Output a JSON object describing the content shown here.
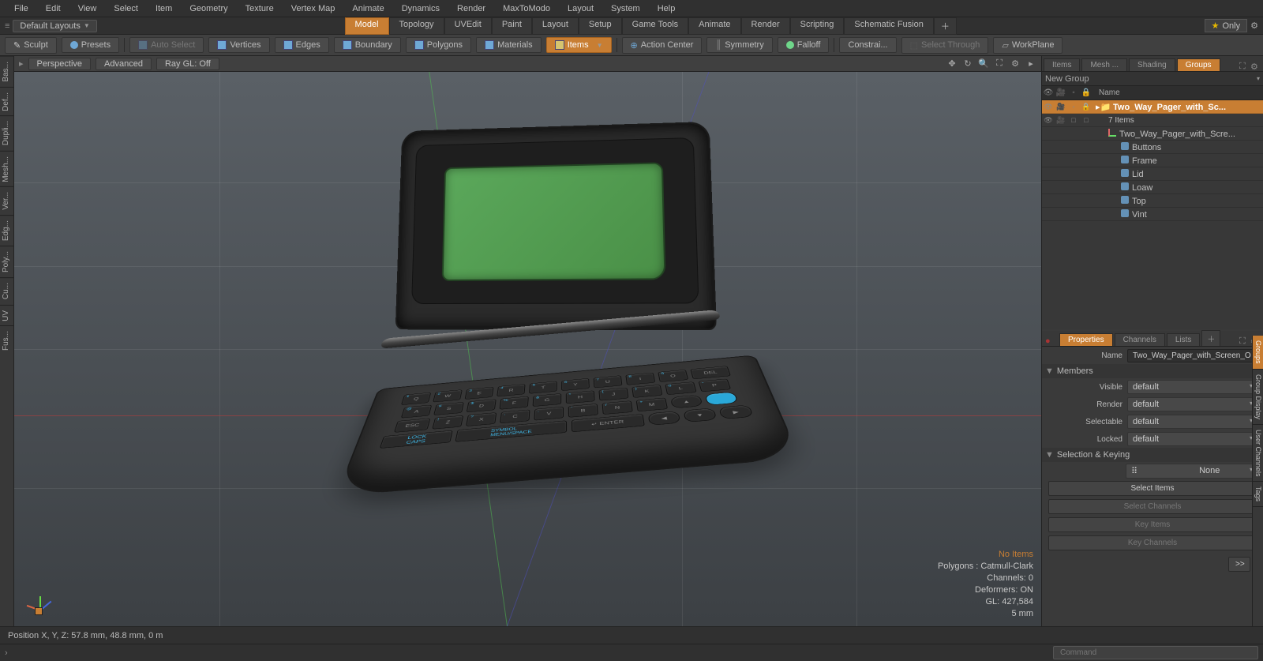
{
  "menubar": [
    "File",
    "Edit",
    "View",
    "Select",
    "Item",
    "Geometry",
    "Texture",
    "Vertex Map",
    "Animate",
    "Dynamics",
    "Render",
    "MaxToModo",
    "Layout",
    "System",
    "Help"
  ],
  "layoutbar": {
    "dropdown": "Default Layouts",
    "tabs": [
      "Model",
      "Topology",
      "UVEdit",
      "Paint",
      "Layout",
      "Setup",
      "Game Tools",
      "Animate",
      "Render",
      "Scripting",
      "Schematic Fusion"
    ],
    "active_tab": "Model",
    "only": "Only"
  },
  "toolbar": {
    "sculpt": "Sculpt",
    "presets": "Presets",
    "auto_select": "Auto Select",
    "vertices": "Vertices",
    "edges": "Edges",
    "boundary": "Boundary",
    "polygons": "Polygons",
    "materials": "Materials",
    "items": "Items",
    "action_center": "Action Center",
    "symmetry": "Symmetry",
    "falloff": "Falloff",
    "constrai": "Constrai...",
    "select_through": "Select Through",
    "workplane": "WorkPlane"
  },
  "vside": [
    "Bas...",
    "Def...",
    "Dupli...",
    "Mesh...",
    "Ver...",
    "Edg...",
    "Poly...",
    "Cu...",
    "UV",
    "Fus..."
  ],
  "vp_head": {
    "perspective": "Perspective",
    "advanced": "Advanced",
    "raygl": "Ray GL: Off"
  },
  "stats": {
    "noitems": "No Items",
    "polygons": "Polygons : Catmull-Clark",
    "channels": "Channels: 0",
    "deformers": "Deformers: ON",
    "gl": "GL: 427,584",
    "unit": "5 mm"
  },
  "right_top_tabs": [
    "Items",
    "Mesh ...",
    "Shading",
    "Groups"
  ],
  "right_top_active": "Groups",
  "newgroup": "New Group",
  "tree_name_hdr": "Name",
  "tree": {
    "root": "Two_Way_Pager_with_Sc...",
    "root_count": "7 Items",
    "loc": "Two_Way_Pager_with_Scre...",
    "children": [
      "Buttons",
      "Frame",
      "Lid",
      "Loaw",
      "Top",
      "Vint"
    ]
  },
  "right_bot_tabs": [
    "Properties",
    "Channels",
    "Lists"
  ],
  "right_bot_active": "Properties",
  "props": {
    "name_label": "Name",
    "name_value": "Two_Way_Pager_with_Screen_O",
    "members": "Members",
    "visible_label": "Visible",
    "visible_value": "default",
    "render_label": "Render",
    "render_value": "default",
    "selectable_label": "Selectable",
    "selectable_value": "default",
    "locked_label": "Locked",
    "locked_value": "default",
    "selkey": "Selection & Keying",
    "none": "None",
    "select_items": "Select Items",
    "select_channels": "Select Channels",
    "key_items": "Key Items",
    "key_channels": "Key Channels",
    "arrow": ">>"
  },
  "rside": [
    "Groups",
    "Group Display",
    "User Channels",
    "Tags"
  ],
  "rside_active": "Groups",
  "status": "Position X, Y, Z:   57.8 mm, 48.8 mm, 0 m",
  "cmd_placeholder": "Command"
}
